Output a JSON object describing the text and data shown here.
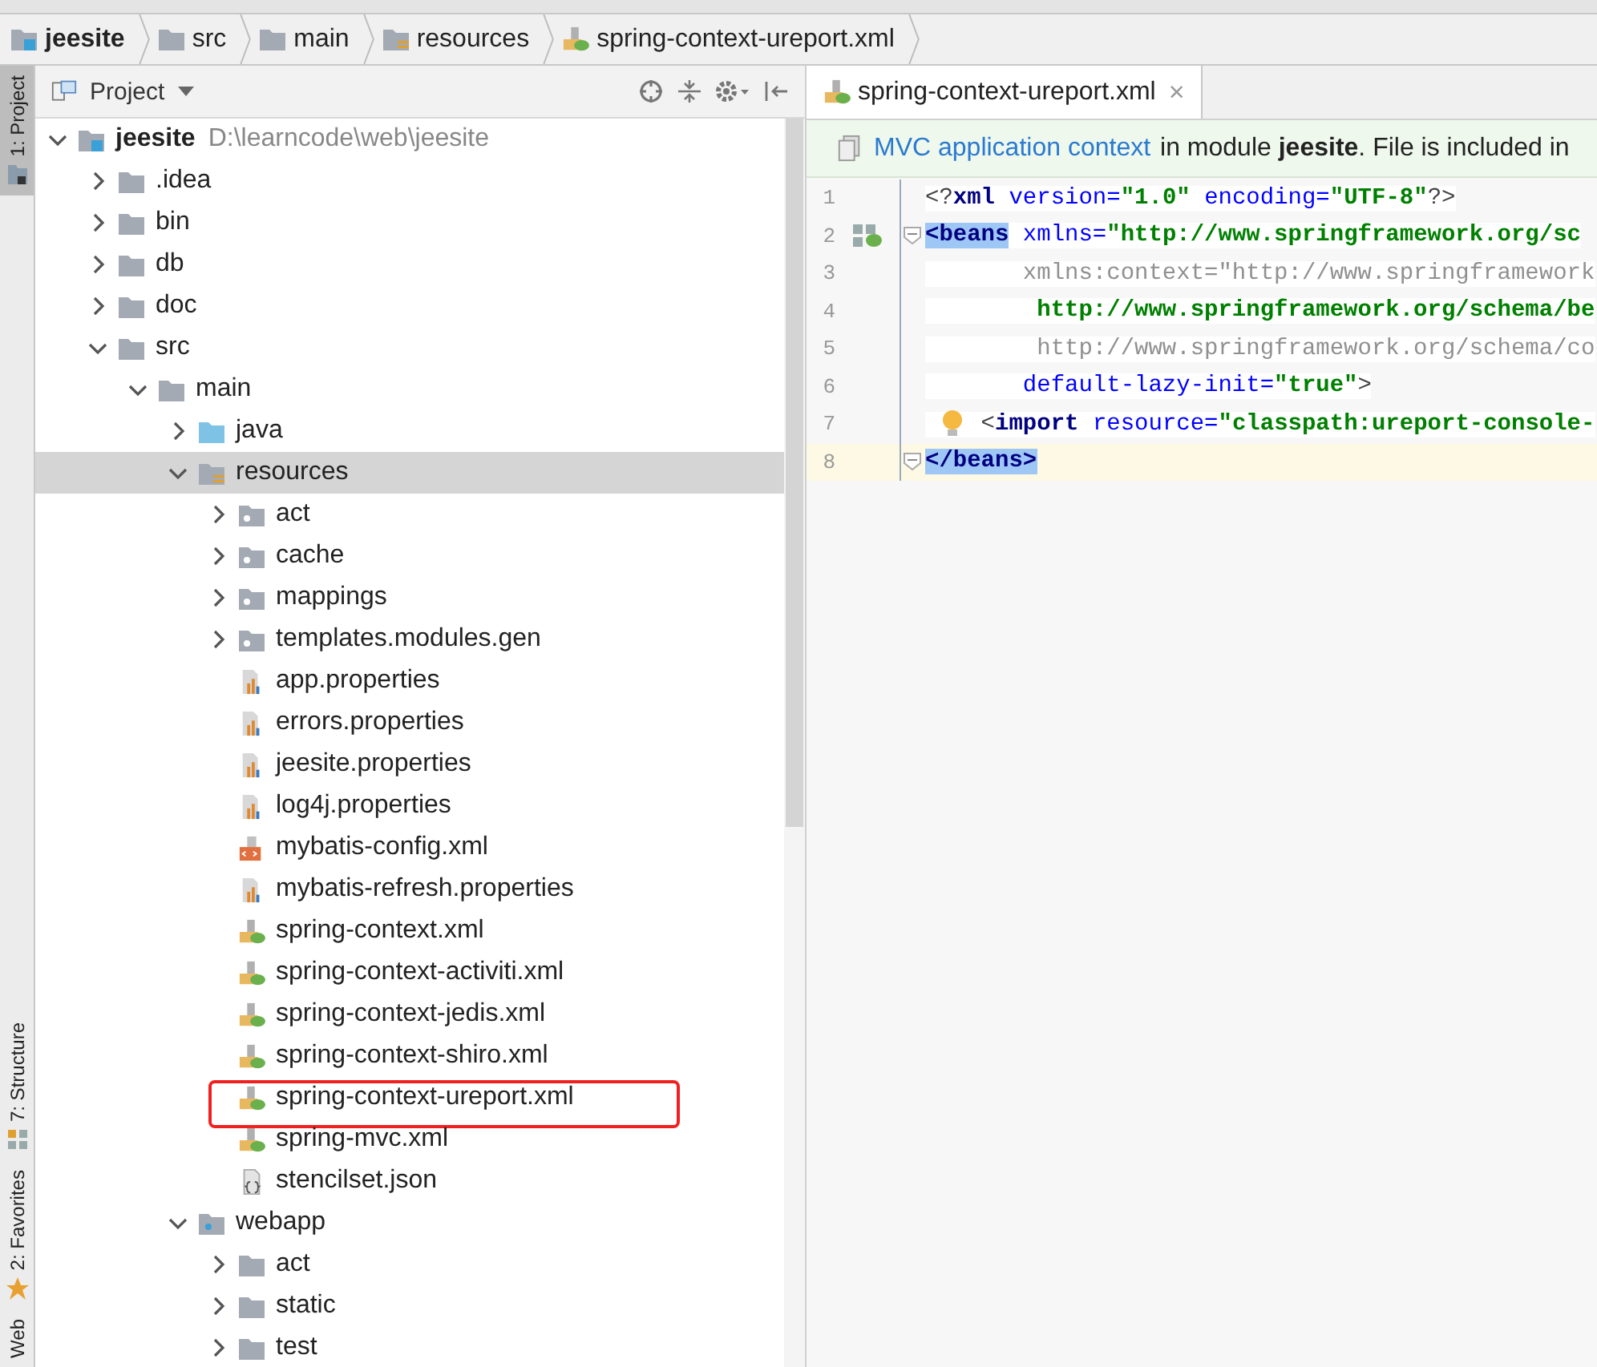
{
  "breadcrumbs": [
    {
      "label": "jeesite",
      "kind": "module"
    },
    {
      "label": "src",
      "kind": "folder"
    },
    {
      "label": "main",
      "kind": "folder"
    },
    {
      "label": "resources",
      "kind": "resources"
    },
    {
      "label": "spring-context-ureport.xml",
      "kind": "spring-xml"
    }
  ],
  "tool_strip": [
    {
      "label": "1: Project",
      "kind": "project",
      "selected": true
    },
    {
      "label": "7: Structure",
      "kind": "structure",
      "selected": false
    },
    {
      "label": "2: Favorites",
      "kind": "favorites",
      "selected": false
    },
    {
      "label": "Web",
      "kind": "none",
      "selected": false
    }
  ],
  "project": {
    "title": "Project",
    "tree": [
      {
        "label": "jeesite",
        "path": "D:\\learncode\\web\\jeesite",
        "kind": "module",
        "expanded": true,
        "selected": false,
        "children": [
          {
            "label": ".idea",
            "kind": "folder",
            "expanded": false,
            "selected": false
          },
          {
            "label": "bin",
            "kind": "folder",
            "expanded": false,
            "selected": false
          },
          {
            "label": "db",
            "kind": "folder",
            "expanded": false,
            "selected": false
          },
          {
            "label": "doc",
            "kind": "folder",
            "expanded": false,
            "selected": false
          },
          {
            "label": "src",
            "kind": "folder",
            "expanded": true,
            "selected": false,
            "children": [
              {
                "label": "main",
                "kind": "folder",
                "expanded": true,
                "selected": false,
                "children": [
                  {
                    "label": "java",
                    "kind": "source",
                    "expanded": false,
                    "selected": false
                  },
                  {
                    "label": "resources",
                    "kind": "resources",
                    "expanded": true,
                    "selected": true,
                    "children": [
                      {
                        "label": "act",
                        "kind": "package",
                        "expanded": false,
                        "selected": false
                      },
                      {
                        "label": "cache",
                        "kind": "package",
                        "expanded": false,
                        "selected": false
                      },
                      {
                        "label": "mappings",
                        "kind": "package",
                        "expanded": false,
                        "selected": false
                      },
                      {
                        "label": "templates.modules.gen",
                        "kind": "package",
                        "expanded": false,
                        "selected": false
                      },
                      {
                        "label": "app.properties",
                        "kind": "properties",
                        "selected": false
                      },
                      {
                        "label": "errors.properties",
                        "kind": "properties",
                        "selected": false
                      },
                      {
                        "label": "jeesite.properties",
                        "kind": "properties",
                        "selected": false
                      },
                      {
                        "label": "log4j.properties",
                        "kind": "properties",
                        "selected": false
                      },
                      {
                        "label": "mybatis-config.xml",
                        "kind": "xml",
                        "selected": false
                      },
                      {
                        "label": "mybatis-refresh.properties",
                        "kind": "properties",
                        "selected": false
                      },
                      {
                        "label": "spring-context.xml",
                        "kind": "spring-xml",
                        "selected": false
                      },
                      {
                        "label": "spring-context-activiti.xml",
                        "kind": "spring-xml",
                        "selected": false
                      },
                      {
                        "label": "spring-context-jedis.xml",
                        "kind": "spring-xml",
                        "selected": false
                      },
                      {
                        "label": "spring-context-shiro.xml",
                        "kind": "spring-xml",
                        "selected": false
                      },
                      {
                        "label": "spring-context-ureport.xml",
                        "kind": "spring-xml",
                        "selected": false,
                        "annotated": true
                      },
                      {
                        "label": "spring-mvc.xml",
                        "kind": "spring-xml",
                        "selected": false
                      },
                      {
                        "label": "stencilset.json",
                        "kind": "json",
                        "selected": false
                      }
                    ]
                  },
                  {
                    "label": "webapp",
                    "kind": "webapp",
                    "expanded": true,
                    "selected": false,
                    "children": [
                      {
                        "label": "act",
                        "kind": "folder",
                        "expanded": false,
                        "selected": false
                      },
                      {
                        "label": "static",
                        "kind": "folder",
                        "expanded": false,
                        "selected": false
                      },
                      {
                        "label": "test",
                        "kind": "folder",
                        "expanded": false,
                        "selected": false
                      }
                    ]
                  }
                ]
              }
            ]
          }
        ]
      }
    ]
  },
  "editor": {
    "tabs": [
      {
        "label": "spring-context-ureport.xml",
        "close": "×",
        "selected": true
      }
    ],
    "banner": {
      "link": "MVC application context",
      "text": "in module **jeesite**. File is included in"
    },
    "lines": [
      {
        "number": "1",
        "tokens": [
          {
            "text": "<?",
            "kind": "punct"
          },
          {
            "text": "xml ",
            "kind": "tag"
          },
          {
            "text": "version=",
            "kind": "attr"
          },
          {
            "text": "\"1.0\" ",
            "kind": "value"
          },
          {
            "text": "encoding=",
            "kind": "attr"
          },
          {
            "text": "\"UTF-8\"",
            "kind": "value"
          },
          {
            "text": "?>",
            "kind": "punct"
          }
        ]
      },
      {
        "number": "2",
        "bean": true,
        "fold": true,
        "tokens": [
          {
            "text": "<beans",
            "kind": "match"
          },
          {
            "text": " xmlns=",
            "kind": "attr"
          },
          {
            "text": "\"http://www.springframework.org/sc",
            "kind": "value"
          }
        ]
      },
      {
        "number": "3",
        "tokens": [
          {
            "text": "       xmlns:context=\"http://www.springframework",
            "kind": "unused"
          }
        ]
      },
      {
        "number": "4",
        "tokens": [
          {
            "text": "        http://www.springframework.org/schema/be",
            "kind": "value"
          }
        ]
      },
      {
        "number": "5",
        "tokens": [
          {
            "text": "        http://www.springframework.org/schema/co",
            "kind": "unused"
          }
        ]
      },
      {
        "number": "6",
        "tokens": [
          {
            "text": "       default-lazy-init=",
            "kind": "attr"
          },
          {
            "text": "\"true\"",
            "kind": "value"
          },
          {
            "text": ">",
            "kind": "punct"
          }
        ]
      },
      {
        "number": "7",
        "bulb": true,
        "tokens": [
          {
            "text": "    <",
            "kind": "punct"
          },
          {
            "text": "import ",
            "kind": "tag"
          },
          {
            "text": "resource=",
            "kind": "attr"
          },
          {
            "text": "\"classpath:ureport-console-",
            "kind": "value"
          }
        ]
      },
      {
        "number": "8",
        "fold": true,
        "current": true,
        "tokens": [
          {
            "text": "</beans>",
            "kind": "match"
          }
        ]
      }
    ]
  }
}
